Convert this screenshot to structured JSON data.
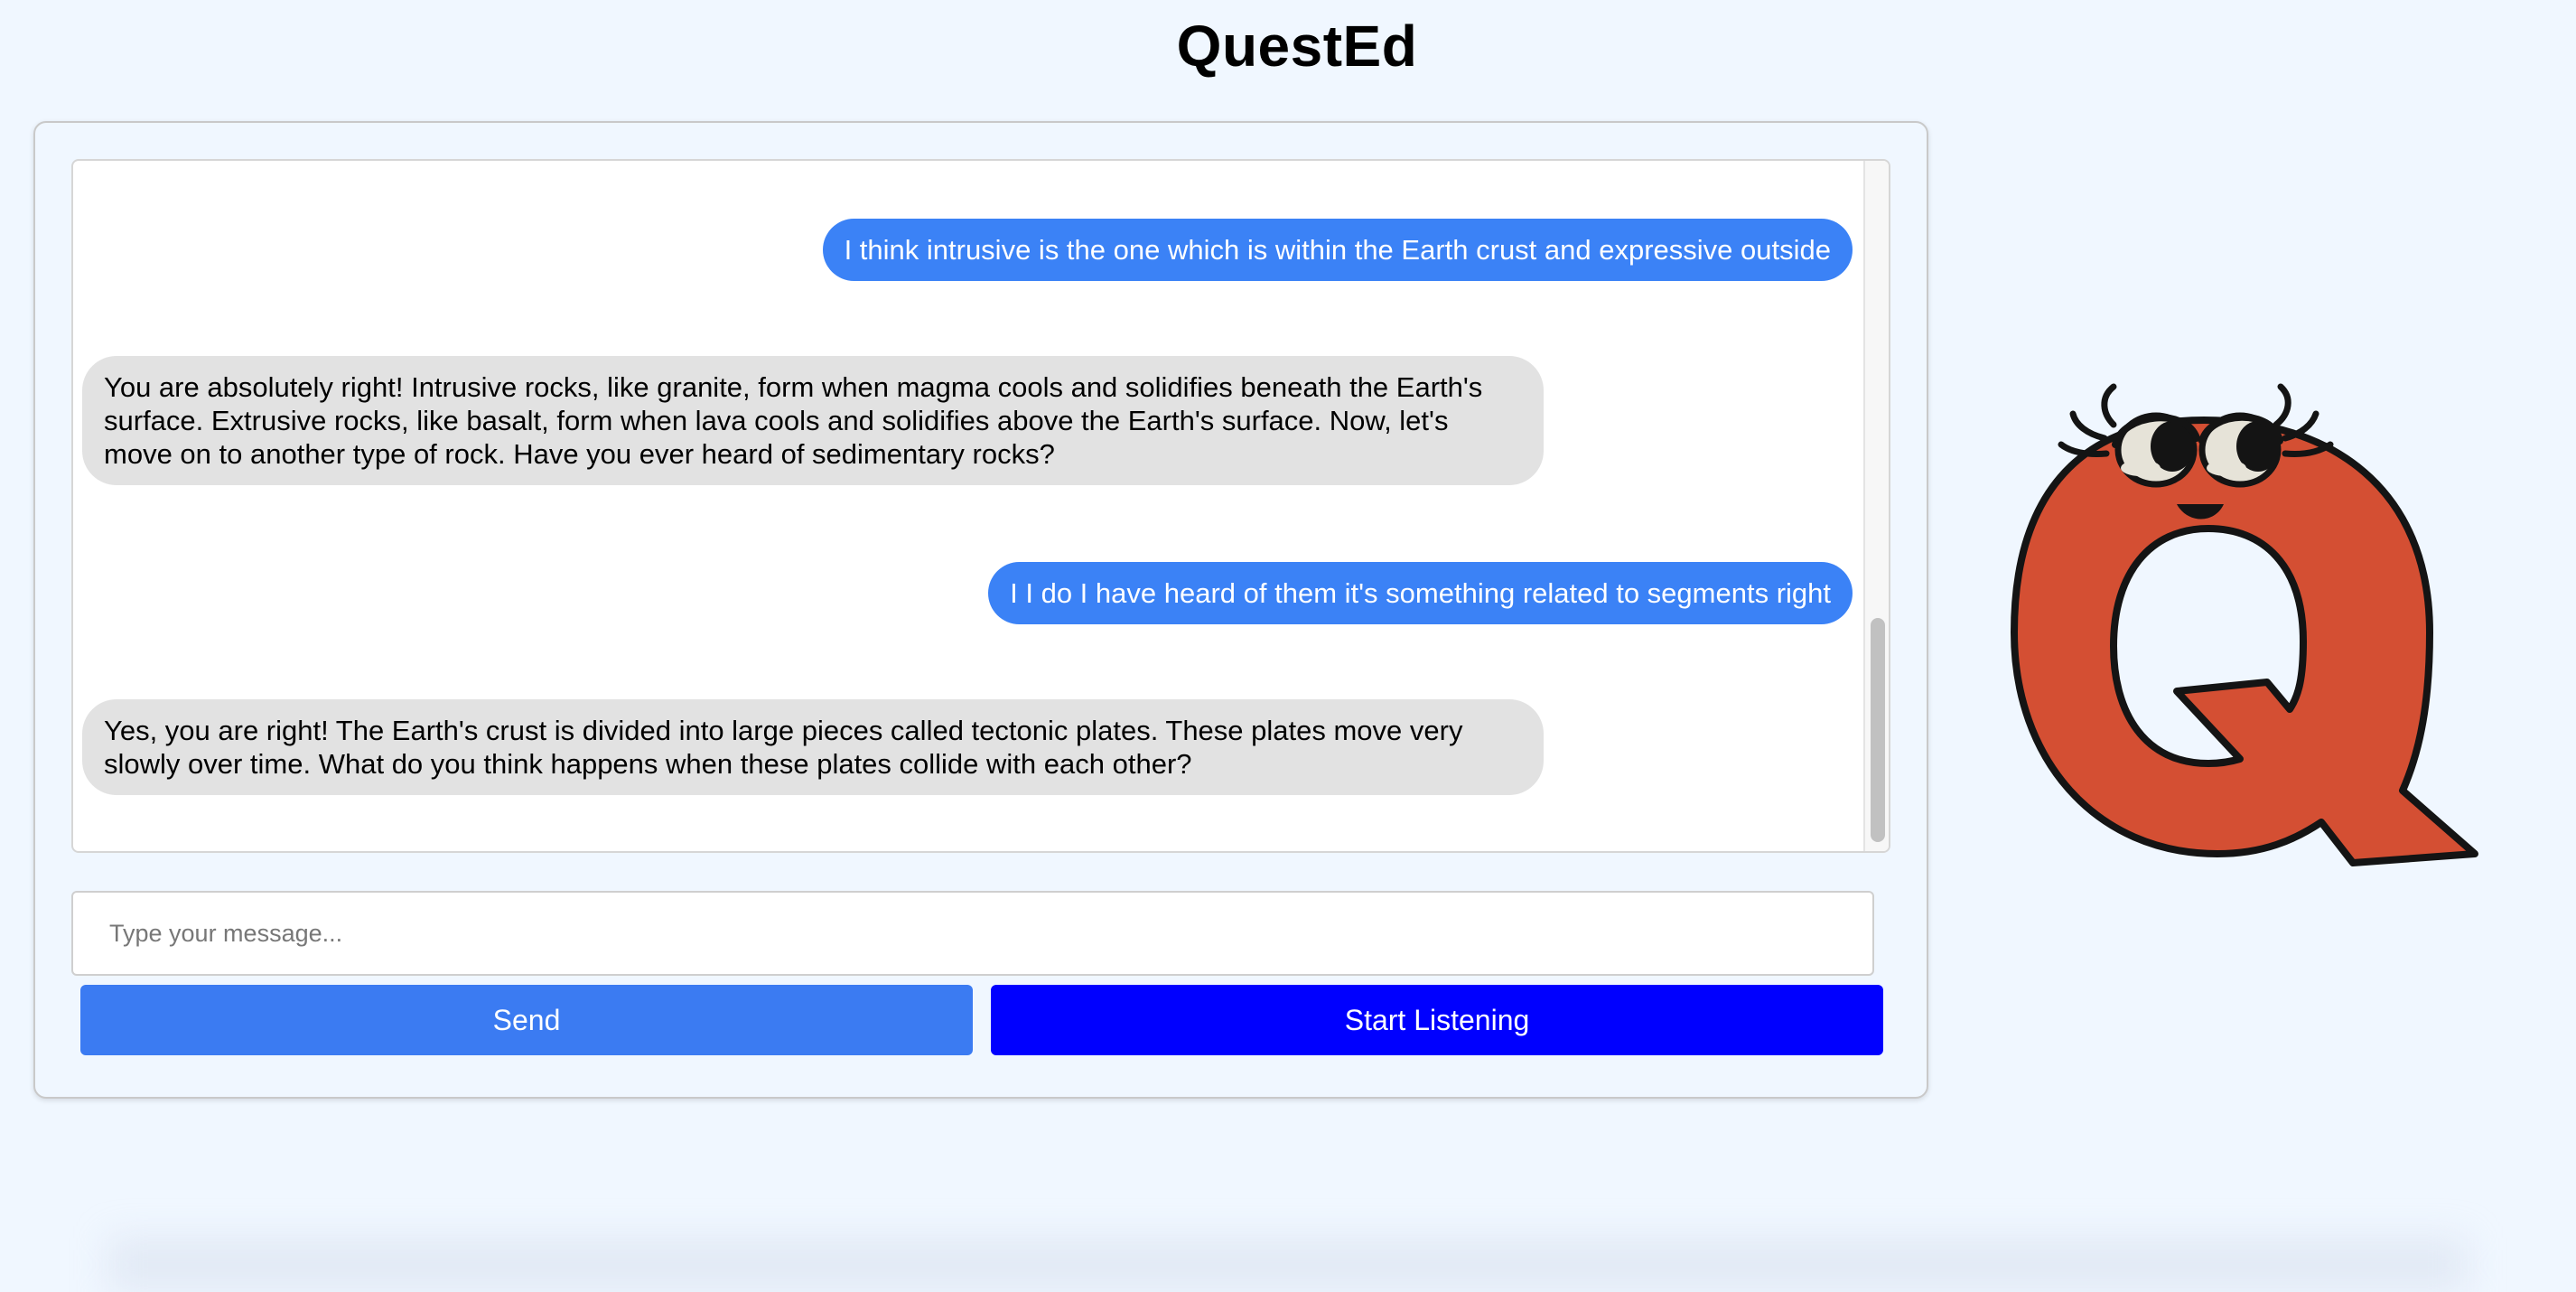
{
  "app": {
    "title": "QuestEd"
  },
  "messages": [
    {
      "role": "user",
      "text": "I think intrusive is the one which is within the Earth crust and expressive outside"
    },
    {
      "role": "assistant",
      "text": "You are absolutely right! Intrusive rocks, like granite, form when magma cools and solidifies beneath the Earth's surface. Extrusive rocks, like basalt, form when lava cools and solidifies above the Earth's surface. Now, let's move on to another type of rock. Have you ever heard of sedimentary rocks?"
    },
    {
      "role": "user",
      "text": "I I do I have heard of them it's something related to segments right"
    },
    {
      "role": "assistant",
      "text": "Yes, you are right! The Earth's crust is divided into large pieces called tectonic plates. These plates move very slowly over time. What do you think happens when these plates collide with each other?"
    }
  ],
  "composer": {
    "placeholder": "Type your message...",
    "value": ""
  },
  "buttons": {
    "send": "Send",
    "listen": "Start Listening"
  },
  "colors": {
    "page_background": "#f0f7ff",
    "user_bubble": "#3b82f6",
    "assistant_bubble": "#e2e2e2",
    "send_button": "#3b7bf2",
    "listen_button": "#0000ff",
    "mascot_red": "#d44f33"
  },
  "icons": {
    "mascot": "q-letter-mascot-icon"
  }
}
